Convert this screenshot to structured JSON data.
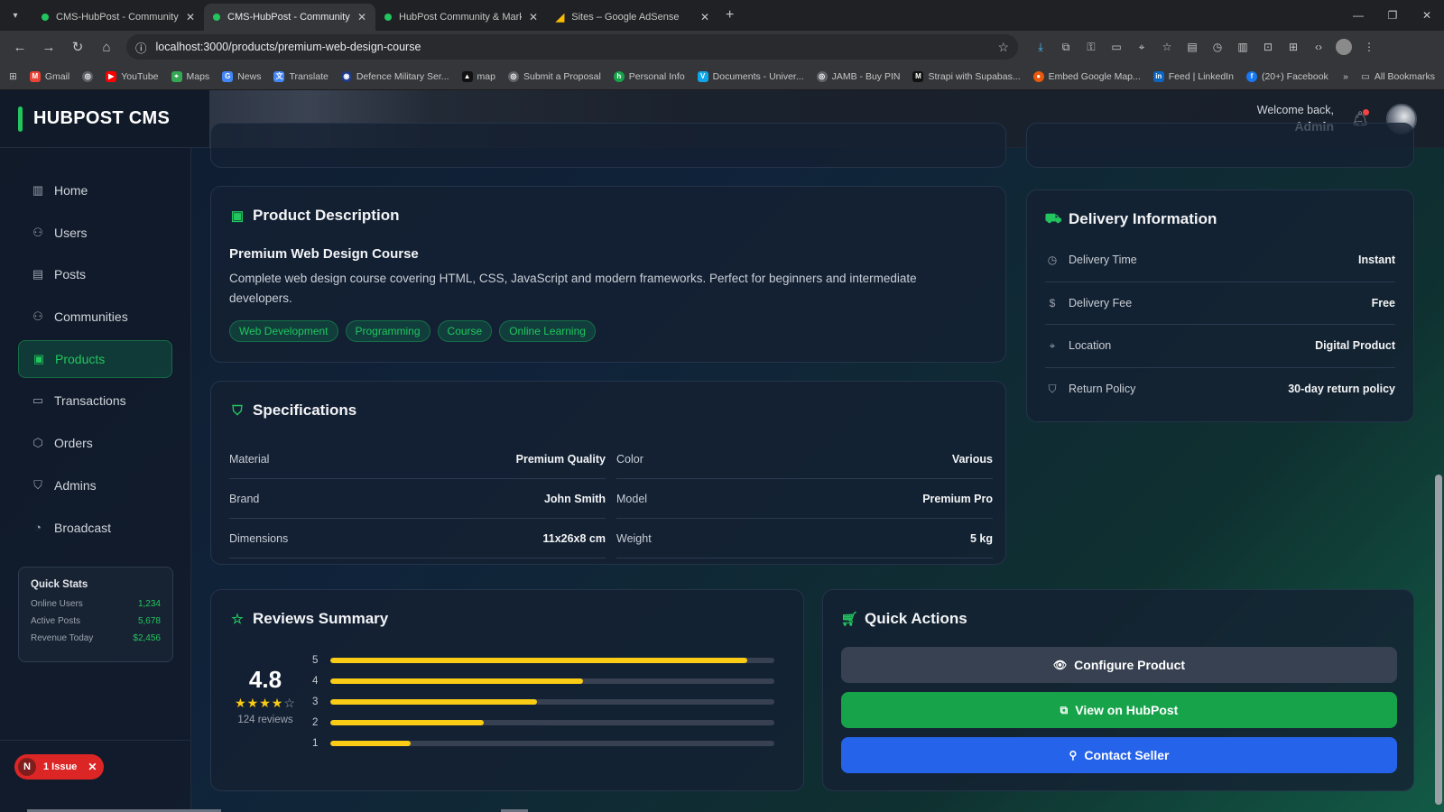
{
  "browser": {
    "tabs": [
      {
        "title": "CMS-HubPost - Community M",
        "active": false
      },
      {
        "title": "CMS-HubPost - Community M",
        "active": true
      },
      {
        "title": "HubPost Community & Market",
        "active": false
      },
      {
        "title": "Sites – Google AdSense",
        "active": false
      }
    ],
    "url": "localhost:3000/products/premium-web-design-course",
    "bookmarks": [
      "Gmail",
      "YouTube",
      "Maps",
      "News",
      "Translate",
      "Defence Military Ser...",
      "map",
      "Submit a Proposal",
      "Personal Info",
      "Documents - Univer...",
      "JAMB - Buy PIN",
      "Strapi with Supabas...",
      "Embed Google Map...",
      "Feed | LinkedIn",
      "(20+) Facebook"
    ],
    "all_bookmarks": "All Bookmarks"
  },
  "app": {
    "brand": "HUBPOST CMS",
    "welcome": "Welcome back,",
    "user": "Admin",
    "accent": "#22c55e"
  },
  "sidebar": {
    "items": [
      {
        "label": "Home",
        "icon": "bar-chart-icon"
      },
      {
        "label": "Users",
        "icon": "users-icon"
      },
      {
        "label": "Posts",
        "icon": "file-icon"
      },
      {
        "label": "Communities",
        "icon": "people-icon"
      },
      {
        "label": "Products",
        "icon": "shopping-bag-icon",
        "active": true
      },
      {
        "label": "Transactions",
        "icon": "credit-card-icon"
      },
      {
        "label": "Orders",
        "icon": "box-icon"
      },
      {
        "label": "Admins",
        "icon": "shield-icon"
      },
      {
        "label": "Broadcast",
        "icon": "broadcast-icon"
      }
    ],
    "quick_stats": {
      "title": "Quick Stats",
      "rows": [
        {
          "label": "Online Users",
          "value": "1,234"
        },
        {
          "label": "Active Posts",
          "value": "5,678"
        },
        {
          "label": "Revenue Today",
          "value": "$2,456"
        }
      ]
    },
    "issue": {
      "badge": "N",
      "label": "1 Issue"
    }
  },
  "description": {
    "title": "Product Description",
    "product_name": "Premium Web Design Course",
    "text": "Complete web design course covering HTML, CSS, JavaScript and modern frameworks. Perfect for beginners and intermediate developers.",
    "tags": [
      "Web Development",
      "Programming",
      "Course",
      "Online Learning"
    ]
  },
  "specifications": {
    "title": "Specifications",
    "rows": [
      {
        "label": "Material",
        "value": "Premium Quality"
      },
      {
        "label": "Color",
        "value": "Various"
      },
      {
        "label": "Brand",
        "value": "John Smith"
      },
      {
        "label": "Model",
        "value": "Premium Pro"
      },
      {
        "label": "Dimensions",
        "value": "11x26x8 cm"
      },
      {
        "label": "Weight",
        "value": "5 kg"
      }
    ]
  },
  "delivery": {
    "title": "Delivery Information",
    "rows": [
      {
        "label": "Delivery Time",
        "value": "Instant",
        "icon": "clock-icon"
      },
      {
        "label": "Delivery Fee",
        "value": "Free",
        "icon": "dollar-icon"
      },
      {
        "label": "Location",
        "value": "Digital Product",
        "icon": "map-pin-icon"
      },
      {
        "label": "Return Policy",
        "value": "30-day return policy",
        "icon": "shield-icon"
      }
    ]
  },
  "reviews": {
    "title": "Reviews Summary",
    "rating": "4.8",
    "stars_filled": 4,
    "stars_total": 5,
    "count": "124 reviews",
    "distribution": [
      {
        "label": "5",
        "fraction": 0.94
      },
      {
        "label": "4",
        "fraction": 0.57
      },
      {
        "label": "3",
        "fraction": 0.465
      },
      {
        "label": "2",
        "fraction": 0.345
      },
      {
        "label": "1",
        "fraction": 0.18
      }
    ]
  },
  "quick_actions": {
    "title": "Quick Actions",
    "configure": "Configure Product",
    "view": "View on HubPost",
    "contact": "Contact Seller"
  }
}
